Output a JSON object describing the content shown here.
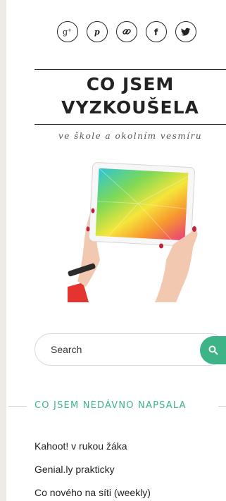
{
  "social": {
    "icons": [
      "google-plus-icon",
      "pinterest-icon",
      "link-icon",
      "facebook-icon",
      "twitter-icon"
    ]
  },
  "site": {
    "title_line1": "CO JSEM",
    "title_line2": "VYZKOUŠELA",
    "tagline": "ve škole a okolním vesmíru"
  },
  "search": {
    "placeholder": "Search"
  },
  "recent": {
    "heading": "CO JSEM NEDÁVNO NAPSALA",
    "posts": [
      "Kahoot! v rukou žáka",
      "Genial.ly prakticky",
      "Co nového na síti (weekly)"
    ]
  },
  "colors": {
    "accent": "#3cb488",
    "sidebar_strip": "#efeae6"
  }
}
